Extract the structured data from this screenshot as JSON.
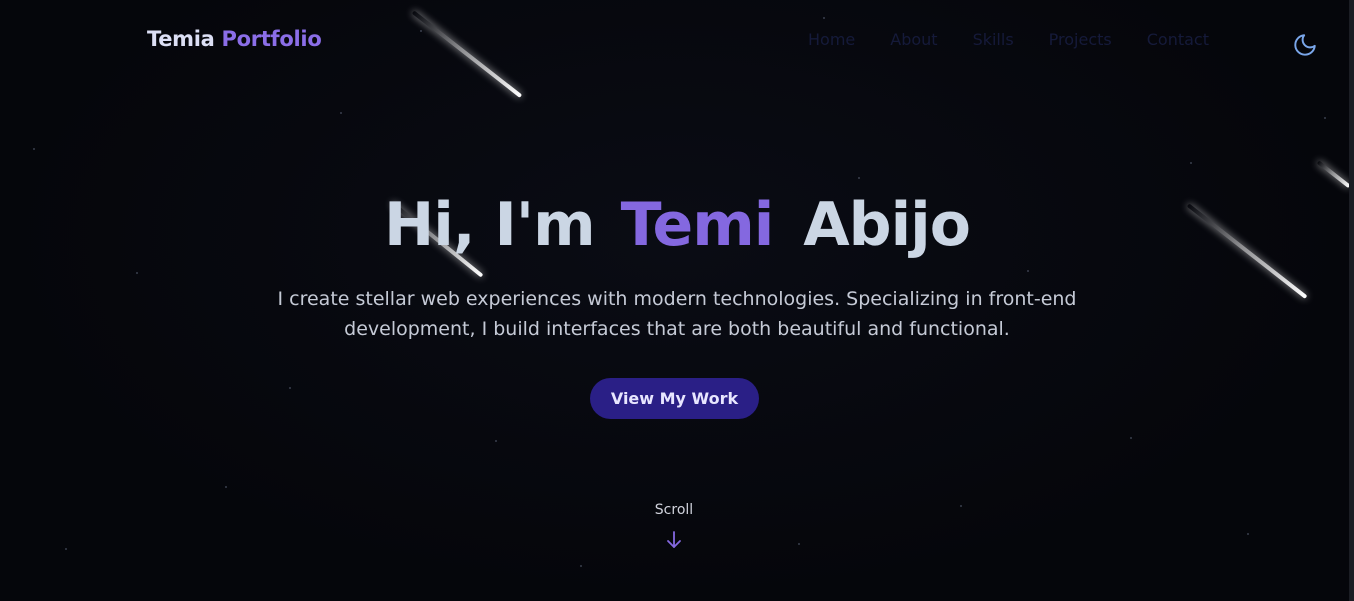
{
  "brand": {
    "first": "Temia",
    "second": "Portfolio"
  },
  "nav": {
    "items": [
      "Home",
      "About",
      "Skills",
      "Projects",
      "Contact"
    ]
  },
  "theme_toggle_icon": "moon-icon",
  "hero": {
    "greeting": "Hi, I'm",
    "first_name": "Temi",
    "last_name": "Abijo",
    "subtitle_line1": "I create stellar web experiences with modern technologies. Specializing in front-end",
    "subtitle_line2": "development, I build interfaces that are both beautiful and functional.",
    "cta_label": "View My Work"
  },
  "scroll": {
    "label": "Scroll",
    "icon": "arrow-down-icon"
  },
  "colors": {
    "background": "#05060b",
    "accent": "#8468e0",
    "button": "#2a1f86",
    "heading": "#cbd6e4"
  }
}
